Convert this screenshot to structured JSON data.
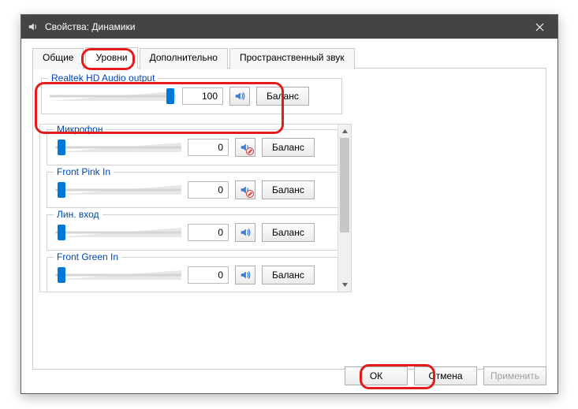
{
  "window": {
    "title": "Свойства: Динамики"
  },
  "tabs": {
    "items": [
      "Общие",
      "Уровни",
      "Дополнительно",
      "Пространственный звук"
    ],
    "active_index": 1
  },
  "output": {
    "title": "Realtek HD Audio output",
    "value": "100",
    "muted": false,
    "balance_label": "Баланс",
    "thumb_pct": 94
  },
  "inputs": [
    {
      "title": "Микрофон",
      "value": "0",
      "muted": true,
      "balance_label": "Баланс",
      "thumb_pct": 2
    },
    {
      "title": "Front Pink In",
      "value": "0",
      "muted": true,
      "balance_label": "Баланс",
      "thumb_pct": 2
    },
    {
      "title": "Лин. вход",
      "value": "0",
      "muted": false,
      "balance_label": "Баланс",
      "thumb_pct": 2
    },
    {
      "title": "Front Green In",
      "value": "0",
      "muted": false,
      "balance_label": "Баланс",
      "thumb_pct": 2
    }
  ],
  "footer": {
    "ok": "ОК",
    "cancel": "Отмена",
    "apply": "Применить"
  }
}
